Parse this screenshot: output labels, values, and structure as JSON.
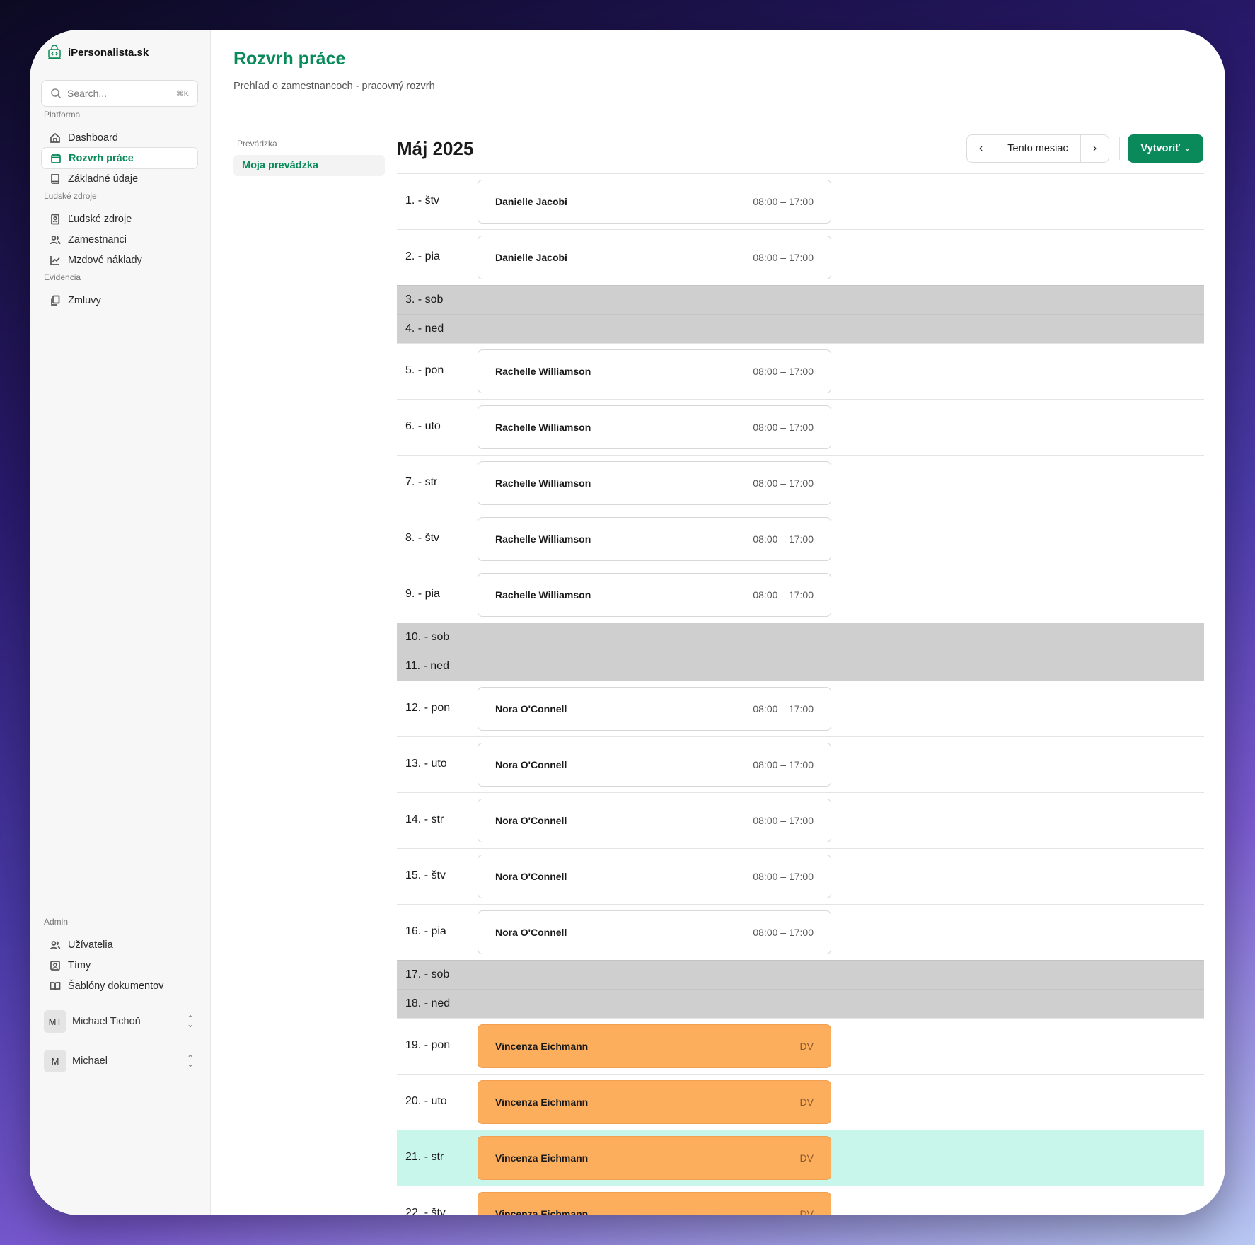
{
  "colors": {
    "accent": "#0a8a5a",
    "weekend": "#cfcfcf",
    "today": "#c8f6ea",
    "leave": "#fcae5c"
  },
  "sidebar": {
    "brand": "iPersonalista.sk",
    "search": {
      "placeholder": "Search...",
      "shortcut": "⌘K"
    },
    "sections": {
      "platform": "Platforma",
      "hr": "Ľudské zdroje",
      "records": "Evidencia",
      "admin": "Admin"
    },
    "items": {
      "dashboard": "Dashboard",
      "schedule": "Rozvrh práce",
      "basic": "Základné údaje",
      "hr": "Ľudské zdroje",
      "employees": "Zamestnanci",
      "payroll": "Mzdové náklady",
      "contracts": "Zmluvy",
      "users": "Užívatelia",
      "teams": "Tímy",
      "templates": "Šablóny dokumentov"
    },
    "user1": {
      "initials": "MT",
      "name": "Michael Tichoň"
    },
    "user2": {
      "initials": "M",
      "name": "Michael"
    }
  },
  "main": {
    "title": "Rozvrh práce",
    "subtitle": "Prehľad o zamestnancoch - pracovný rozvrh",
    "subnav": {
      "label": "Prevádzka",
      "item": "Moja prevádzka"
    },
    "month": "Máj 2025",
    "this_month": "Tento mesiac",
    "create": "Vytvoriť"
  },
  "days": [
    {
      "day": "1. - štv",
      "type": "work",
      "name": "Danielle Jacobi",
      "time": "08:00 – 17:00"
    },
    {
      "day": "2. - pia",
      "type": "work",
      "name": "Danielle Jacobi",
      "time": "08:00 – 17:00"
    },
    {
      "day": "3. - sob",
      "type": "weekend"
    },
    {
      "day": "4. - ned",
      "type": "weekend"
    },
    {
      "day": "5. - pon",
      "type": "work",
      "name": "Rachelle Williamson",
      "time": "08:00 – 17:00"
    },
    {
      "day": "6. - uto",
      "type": "work",
      "name": "Rachelle Williamson",
      "time": "08:00 – 17:00"
    },
    {
      "day": "7. - str",
      "type": "work",
      "name": "Rachelle Williamson",
      "time": "08:00 – 17:00"
    },
    {
      "day": "8. - štv",
      "type": "work",
      "name": "Rachelle Williamson",
      "time": "08:00 – 17:00"
    },
    {
      "day": "9. - pia",
      "type": "work",
      "name": "Rachelle Williamson",
      "time": "08:00 – 17:00"
    },
    {
      "day": "10. - sob",
      "type": "weekend"
    },
    {
      "day": "11. - ned",
      "type": "weekend"
    },
    {
      "day": "12. - pon",
      "type": "work",
      "name": "Nora O'Connell",
      "time": "08:00 – 17:00"
    },
    {
      "day": "13. - uto",
      "type": "work",
      "name": "Nora O'Connell",
      "time": "08:00 – 17:00"
    },
    {
      "day": "14. - str",
      "type": "work",
      "name": "Nora O'Connell",
      "time": "08:00 – 17:00"
    },
    {
      "day": "15. - štv",
      "type": "work",
      "name": "Nora O'Connell",
      "time": "08:00 – 17:00"
    },
    {
      "day": "16. - pia",
      "type": "work",
      "name": "Nora O'Connell",
      "time": "08:00 – 17:00"
    },
    {
      "day": "17. - sob",
      "type": "weekend"
    },
    {
      "day": "18. - ned",
      "type": "weekend"
    },
    {
      "day": "19. - pon",
      "type": "leave",
      "name": "Vincenza Eichmann",
      "time": "DV"
    },
    {
      "day": "20. - uto",
      "type": "leave",
      "name": "Vincenza Eichmann",
      "time": "DV"
    },
    {
      "day": "21. - str",
      "type": "leave",
      "name": "Vincenza Eichmann",
      "time": "DV",
      "today": true
    },
    {
      "day": "22. - štv",
      "type": "leave",
      "name": "Vincenza Eichmann",
      "time": "DV"
    }
  ]
}
